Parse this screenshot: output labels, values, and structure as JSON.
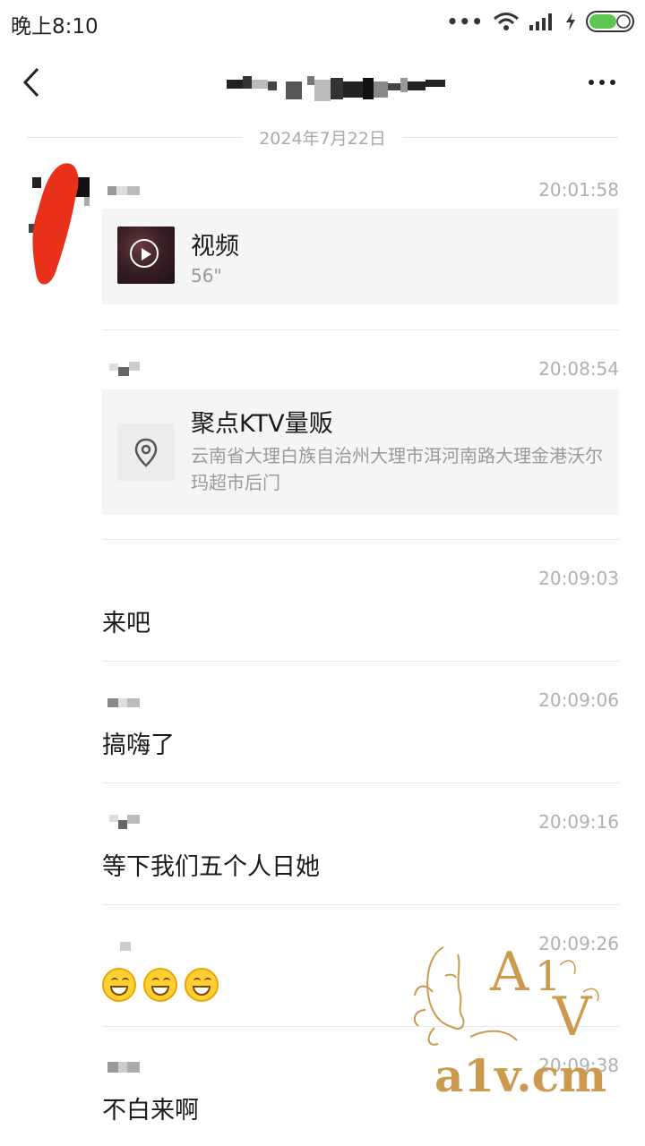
{
  "status_bar": {
    "time": "晚上8:10",
    "battery_color": "#5dc552"
  },
  "header": {
    "back_icon": "chevron-left-icon",
    "more_icon": "more-horizontal-icon"
  },
  "date_divider": "2024年7月22日",
  "messages": [
    {
      "time": "20:01:58",
      "type": "video",
      "title": "视频",
      "duration": "56\""
    },
    {
      "time": "20:08:54",
      "type": "location",
      "title": "聚点KTV量贩",
      "address": "云南省大理白族自治州大理市洱河南路大理金港沃尔玛超市后门"
    },
    {
      "time": "20:09:03",
      "type": "text",
      "text": "来吧"
    },
    {
      "time": "20:09:06",
      "type": "text",
      "text": "搞嗨了"
    },
    {
      "time": "20:09:16",
      "type": "text",
      "text": "等下我们五个人日她"
    },
    {
      "time": "20:09:26",
      "type": "emoji",
      "emoji": "grin-emoji",
      "count": 3
    },
    {
      "time": "20:09:38",
      "type": "text",
      "text": "不白来啊"
    }
  ],
  "watermark": {
    "logo": "A1V",
    "site": "a1v.cm",
    "color": "#cb9a4f"
  }
}
